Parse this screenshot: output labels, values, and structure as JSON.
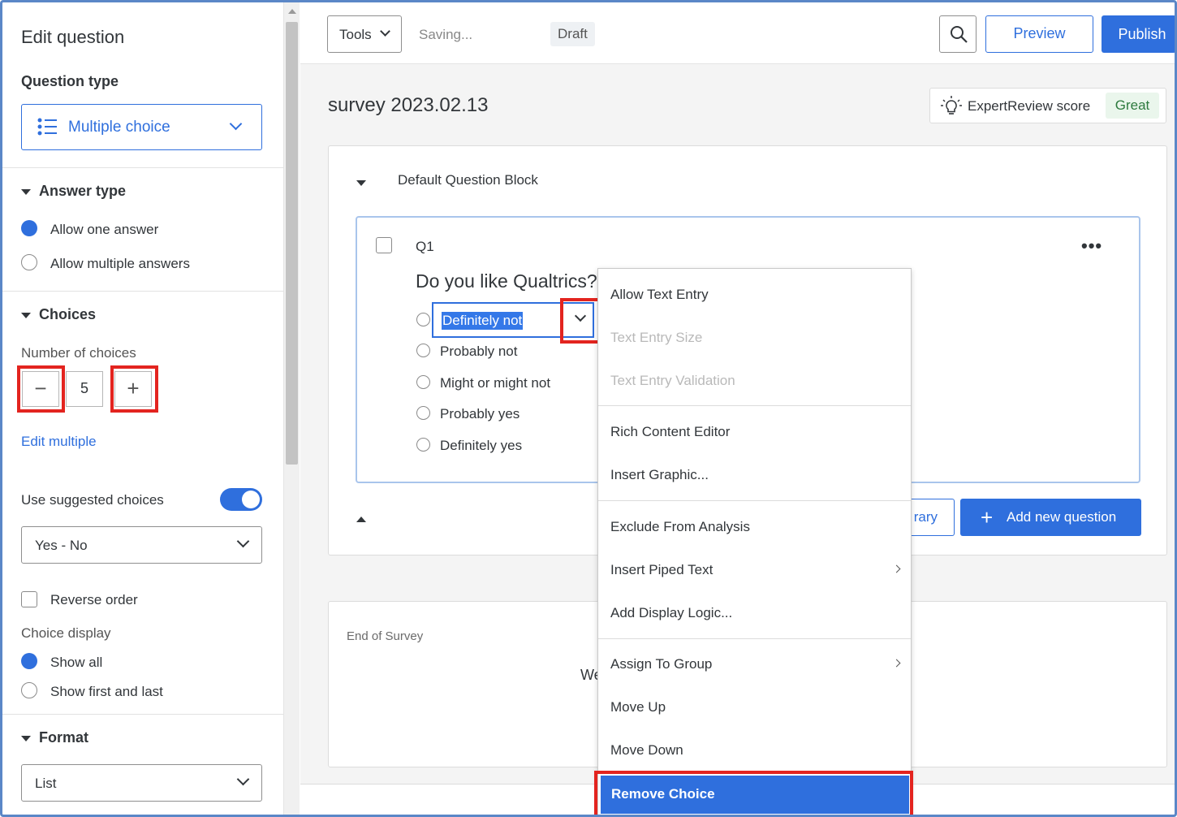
{
  "sidebar": {
    "title": "Edit question",
    "question_type_heading": "Question type",
    "question_type_value": "Multiple choice",
    "answer_type_heading": "Answer type",
    "answer_options": [
      "Allow one answer",
      "Allow multiple answers"
    ],
    "choices_heading": "Choices",
    "number_of_choices_label": "Number of choices",
    "number_of_choices": "5",
    "minus_symbol": "−",
    "plus_symbol": "+",
    "edit_multiple": "Edit multiple",
    "use_suggested_label": "Use suggested choices",
    "suggested_value": "Yes - No",
    "reverse_order": "Reverse order",
    "choice_display_label": "Choice display",
    "display_options": [
      "Show all",
      "Show first and last"
    ],
    "format_heading": "Format",
    "format_value": "List"
  },
  "toolbar": {
    "tools": "Tools",
    "saving": "Saving...",
    "draft": "Draft",
    "preview": "Preview",
    "publish": "Publish"
  },
  "survey": {
    "title": "survey 2023.02.13",
    "expert_label": "ExpertReview score",
    "expert_value": "Great",
    "block_title": "Default Question Block",
    "question_id": "Q1",
    "question_text": "Do you like Qualtrics?",
    "choices": [
      "Definitely not",
      "Probably not",
      "Might or might not",
      "Probably yes",
      "Definitely yes"
    ],
    "library_btn": "rary",
    "add_question": "Add new question",
    "end_title": "End of Survey",
    "end_text": "We"
  },
  "menu": {
    "items": [
      "Allow Text Entry",
      "Text Entry Size",
      "Text Entry Validation",
      "Rich Content Editor",
      "Insert Graphic...",
      "Exclude From Analysis",
      "Insert Piped Text",
      "Add Display Logic...",
      "Assign To Group",
      "Move Up",
      "Move Down",
      "Remove Choice"
    ]
  },
  "colors": {
    "accent": "#2f6fdd",
    "highlight": "#e3241f",
    "great_bg": "#eaf6ec"
  }
}
